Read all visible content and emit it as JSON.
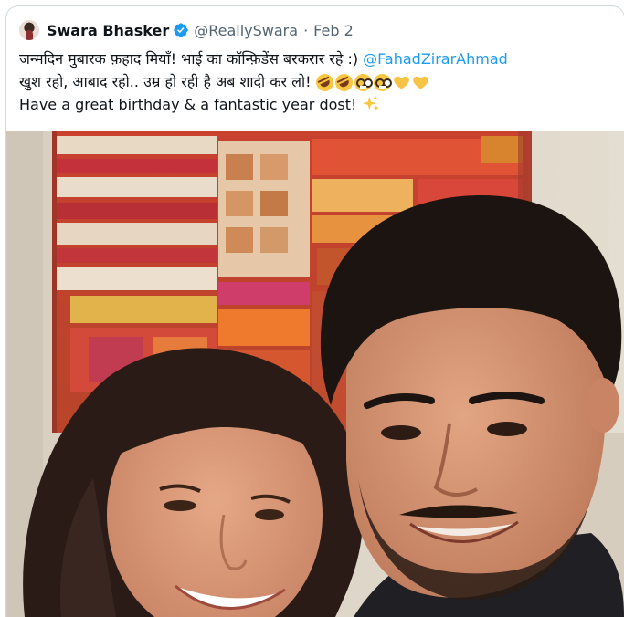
{
  "tweet": {
    "display_name": "Swara Bhasker",
    "handle": "@ReallySwara",
    "separator": "·",
    "date": "Feb 2",
    "verified": true,
    "text_line1": "जन्मदिन मुबारक फ़हाद मियाँ! भाई का कॉन्फ़िडेंस बरकरार रहे :) ",
    "mention": "@FahadZirarAhmad",
    "text_line2": "खुश रहो, आबाद रहो..  उम्र हो रही है अब शादी कर लो! ",
    "text_line3": "Have a great birthday & a fantastic year dost! ",
    "emojis_line2": [
      "rolling-on-floor-laughing",
      "rolling-on-floor-laughing",
      "nerd-face",
      "nerd-face",
      "yellow-heart",
      "yellow-heart"
    ],
    "emoji_line3": "sparkles"
  },
  "colors": {
    "link": "#1d9bf0",
    "secondary_text": "#536471",
    "verified_badge": "#1d9bf0",
    "border": "#cfd9de"
  },
  "media": {
    "type": "photo",
    "subject": "selfie"
  }
}
